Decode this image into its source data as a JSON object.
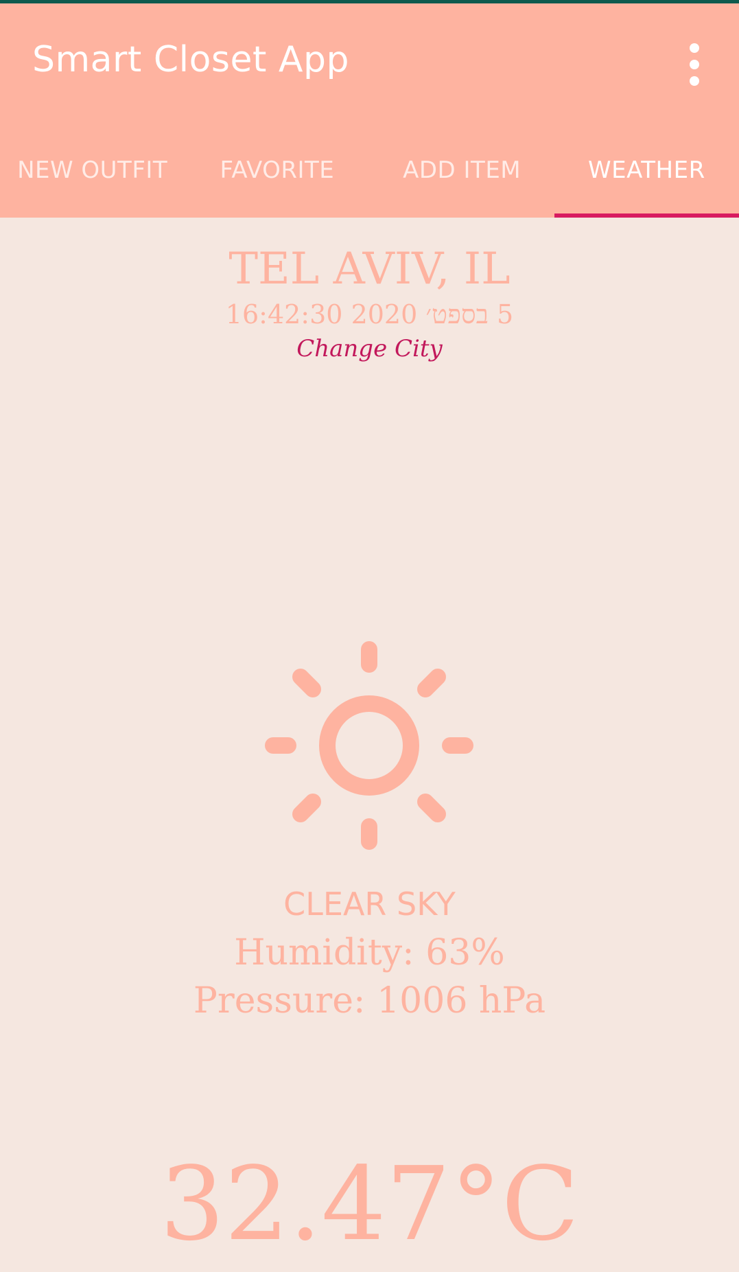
{
  "app": {
    "title": "Smart Closet App",
    "menu_icon": "more-vertical-icon"
  },
  "tabs": [
    {
      "label": "NEW OUTFIT",
      "active": false
    },
    {
      "label": "FAVORITE",
      "active": false
    },
    {
      "label": "ADD ITEM",
      "active": false
    },
    {
      "label": "WEATHER",
      "active": true
    }
  ],
  "weather": {
    "city": "TEL AVIV, IL",
    "datetime": "5 בספט׳ 2020 16:42:30",
    "change_city_label": "Change City",
    "icon": "sun-icon",
    "condition": "CLEAR SKY",
    "humidity": "Humidity: 63%",
    "pressure": "Pressure: 1006 hPa",
    "temperature": "32.47°C"
  },
  "colors": {
    "primary": "#feb3a0",
    "accent": "#d81b60",
    "link": "#c2185b",
    "background": "#f5e7e0",
    "status_bar": "#0e5a4e"
  }
}
